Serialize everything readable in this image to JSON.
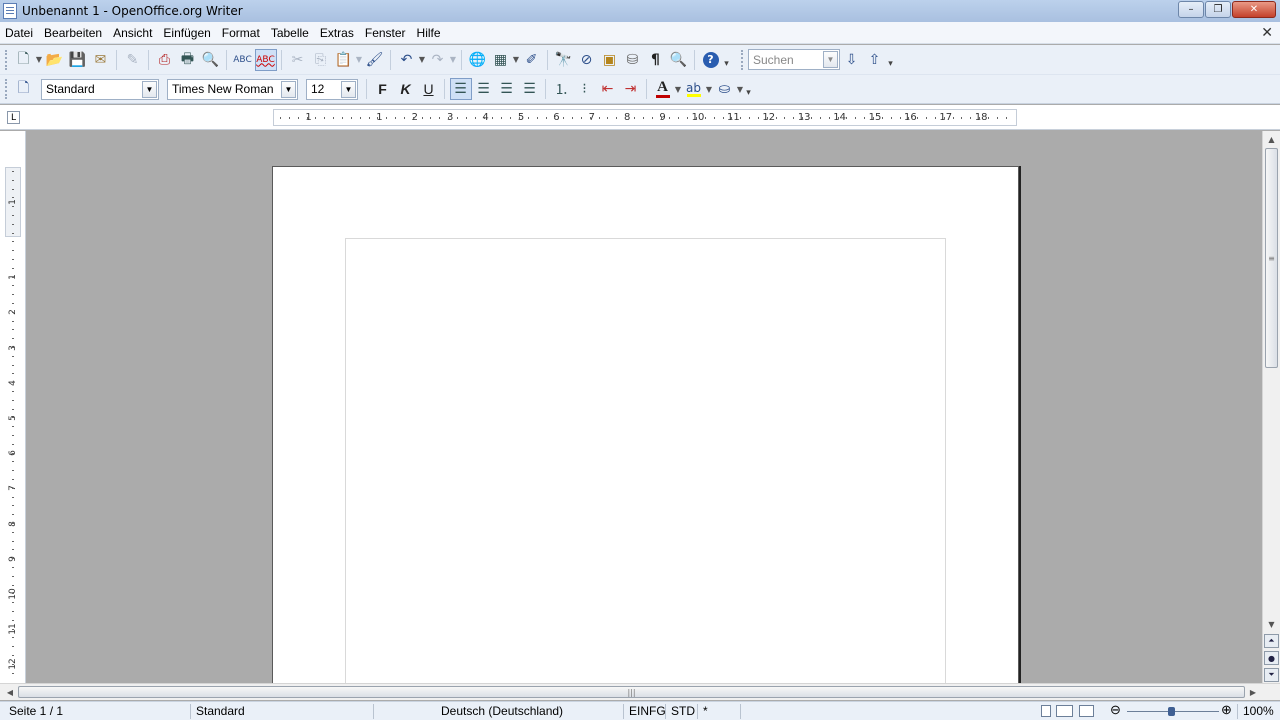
{
  "window": {
    "title": "Unbenannt 1 - OpenOffice.org Writer",
    "minimize_glyph": "–",
    "maximize_glyph": "❐",
    "close_glyph": "✕",
    "doc_close_glyph": "✕"
  },
  "menu": [
    "Datei",
    "Bearbeiten",
    "Ansicht",
    "Einfügen",
    "Format",
    "Tabelle",
    "Extras",
    "Fenster",
    "Hilfe"
  ],
  "standard_toolbar": {
    "search_placeholder": "Suchen"
  },
  "format_toolbar": {
    "paragraph_style": "Standard",
    "font_name": "Times New Roman",
    "font_size": "12",
    "bold_label": "F",
    "italic_label": "K",
    "underline_label": "U"
  },
  "ruler": {
    "horizontal_numbers": [
      "1",
      "1",
      "2",
      "3",
      "4",
      "5",
      "6",
      "7",
      "8",
      "9",
      "10",
      "11",
      "12",
      "13",
      "14",
      "15",
      "16",
      "17",
      "18"
    ],
    "vertical_numbers": [
      "1",
      "1",
      "2",
      "3",
      "4",
      "5",
      "6",
      "7",
      "8",
      "9",
      "10",
      "11",
      "12"
    ]
  },
  "statusbar": {
    "page": "Seite 1 / 1",
    "page_style": "Standard",
    "language": "Deutsch (Deutschland)",
    "insert_mode": "EINFG",
    "selection_mode": "STD",
    "modified": "*",
    "zoom": "100%"
  },
  "icons": {
    "new": "new-document-icon",
    "open": "open-folder-icon",
    "save": "save-icon",
    "mail": "mail-document-icon",
    "edit": "edit-file-icon",
    "pdf": "export-pdf-icon",
    "print": "print-icon",
    "preview": "page-preview-icon",
    "spell": "spellcheck-icon",
    "autospell": "auto-spellcheck-icon",
    "cut": "cut-icon",
    "copy": "copy-icon",
    "paste": "paste-icon",
    "clone": "clone-formatting-icon",
    "undo": "undo-icon",
    "redo": "redo-icon",
    "hyperlink": "hyperlink-icon",
    "table": "table-icon",
    "draw": "show-draw-functions-icon",
    "find": "find-replace-icon",
    "navigator": "navigator-icon",
    "gallery": "gallery-icon",
    "datasources": "data-sources-icon",
    "formatting_marks": "formatting-marks-icon",
    "zoom": "zoom-icon",
    "help": "help-icon"
  },
  "colors": {
    "titlebar": "#bcd1ec",
    "toolbar": "#eaf0f8",
    "canvas": "#ababab",
    "page": "#ffffff",
    "font_color_bar": "#c00000",
    "highlight_bar": "#ffff00"
  }
}
